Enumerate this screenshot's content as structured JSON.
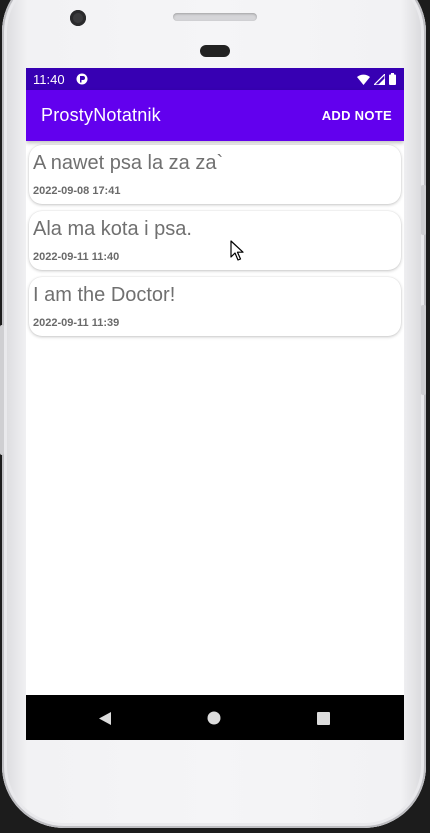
{
  "status_bar": {
    "time": "11:40",
    "icons": [
      "app-notification-icon",
      "wifi-icon",
      "signal-icon",
      "battery-icon"
    ]
  },
  "app_bar": {
    "title": "ProstyNotatnik",
    "action_label": "ADD NOTE"
  },
  "notes": [
    {
      "title": "A nawet psa la za za`",
      "date": "2022-09-08 17:41"
    },
    {
      "title": "Ala ma kota i psa.",
      "date": "2022-09-11 11:40"
    },
    {
      "title": "I am the Doctor!",
      "date": "2022-09-11 11:39"
    }
  ],
  "navigation": {
    "buttons": [
      "back-icon",
      "home-icon",
      "recents-icon"
    ]
  },
  "colors": {
    "status_bar": "#3700b3",
    "app_bar": "#6200ee",
    "nav_bar": "#000000",
    "note_title_text": "#707070",
    "note_date_text": "#6a6a6a"
  }
}
